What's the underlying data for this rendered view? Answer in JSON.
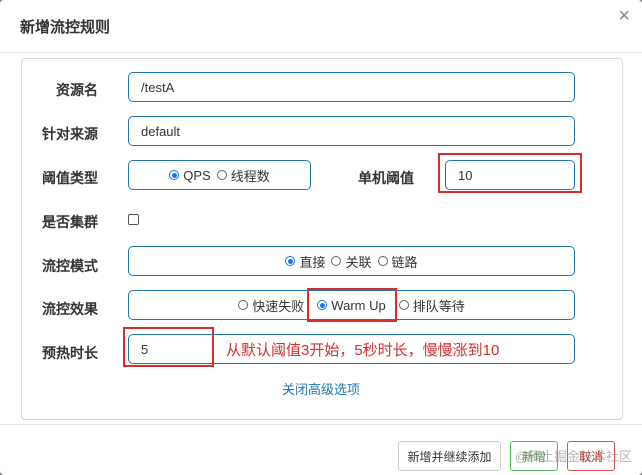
{
  "dialog": {
    "title": "新增流控规则",
    "close": "×"
  },
  "form": {
    "resource": {
      "label": "资源名",
      "value": "/testA"
    },
    "limit_app": {
      "label": "针对来源",
      "value": "default"
    },
    "grade": {
      "label": "阈值类型",
      "options": [
        "QPS",
        "线程数"
      ],
      "selected": "QPS"
    },
    "threshold": {
      "label": "单机阈值",
      "value": "10"
    },
    "cluster": {
      "label": "是否集群",
      "checked": false
    },
    "strategy": {
      "label": "流控模式",
      "options": [
        "直接",
        "关联",
        "链路"
      ],
      "selected": "直接"
    },
    "behavior": {
      "label": "流控效果",
      "options": [
        "快速失败",
        "Warm Up",
        "排队等待"
      ],
      "selected": "Warm Up"
    },
    "warmup": {
      "label": "预热时长",
      "value": "5"
    }
  },
  "annotation": "从默认阈值3开始，5秒时长，慢慢涨到10",
  "advanced_link": "关闭高级选项",
  "footer": {
    "add_continue": "新增并继续添加",
    "add": "新增",
    "cancel": "取消"
  },
  "watermark": "@稀土掘金技术社区",
  "colors": {
    "accent": "#1f78b4",
    "highlight": "#d32f2f"
  }
}
